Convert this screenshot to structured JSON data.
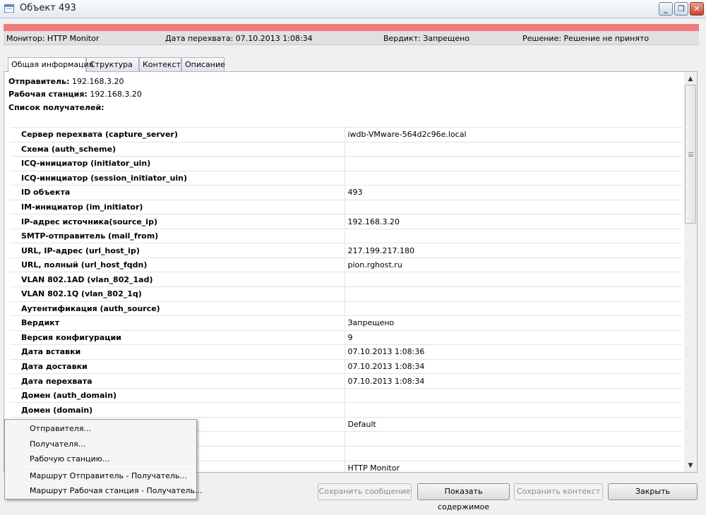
{
  "window": {
    "title": "Объект 493",
    "minimize_label": "_",
    "maximize_label": "❐",
    "close_label": "✕"
  },
  "status": {
    "monitor": "Монитор: HTTP Monitor",
    "capture_date": "Дата перехвата: 07.10.2013 1:08:34",
    "verdict": "Вердикт: Запрещено",
    "decision": "Решение: Решение не принято",
    "bar_color": "#ee7b79"
  },
  "tabs": [
    {
      "label": "Общая информация"
    },
    {
      "label": "Структура"
    },
    {
      "label": "Контекст"
    },
    {
      "label": "Описание"
    }
  ],
  "header": {
    "sender_label": "Отправитель:",
    "sender_value": "192.168.3.20",
    "workstation_label": "Рабочая станция:",
    "workstation_value": "192.168.3.20",
    "recipients_label": "Список получателей:"
  },
  "properties": [
    {
      "key": "Сервер перехвата (capture_server)",
      "value": "iwdb-VMware-564d2c96e.local"
    },
    {
      "key": "Схема (auth_scheme)",
      "value": ""
    },
    {
      "key": "ICQ-инициатор (initiator_uin)",
      "value": ""
    },
    {
      "key": "ICQ-инициатор (session_initiator_uin)",
      "value": ""
    },
    {
      "key": "ID объекта",
      "value": "493"
    },
    {
      "key": "IM-инициатор (im_initiator)",
      "value": ""
    },
    {
      "key": "IP-адрес источника(source_ip)",
      "value": "192.168.3.20"
    },
    {
      "key": "SMTP-отправитель (mail_from)",
      "value": ""
    },
    {
      "key": "URL, IP-адрес (url_host_ip)",
      "value": "217.199.217.180"
    },
    {
      "key": "URL, полный (url_host_fqdn)",
      "value": "pion.rghost.ru"
    },
    {
      "key": "VLAN 802.1AD (vlan_802_1ad)",
      "value": ""
    },
    {
      "key": "VLAN 802.1Q (vlan_802_1q)",
      "value": ""
    },
    {
      "key": "Аутентификация (auth_source)",
      "value": ""
    },
    {
      "key": "Вердикт",
      "value": "Запрещено"
    },
    {
      "key": "Версия конфигурации",
      "value": "9"
    },
    {
      "key": "Дата вставки",
      "value": "07.10.2013 1:08:36"
    },
    {
      "key": "Дата доставки",
      "value": "07.10.2013 1:08:34"
    },
    {
      "key": "Дата перехвата",
      "value": "07.10.2013 1:08:34"
    },
    {
      "key": "Домен (auth_domain)",
      "value": ""
    },
    {
      "key": "Домен (domain)",
      "value": ""
    },
    {
      "key": "",
      "value": "Default"
    },
    {
      "key": "",
      "value": ""
    },
    {
      "key": "",
      "value": ""
    },
    {
      "key": "",
      "value": "HTTP Monitor"
    }
  ],
  "scrollbar": {
    "up_icon": "▲",
    "down_icon": "▼"
  },
  "context_menu": {
    "items": [
      "Отправителя...",
      "Получателя...",
      "Рабочую станцию...",
      "Маршрут Отправитель - Получатель...",
      "Маршрут Рабочая станция - Получатель..."
    ]
  },
  "buttons": {
    "save_message": "Сохранить сообщение",
    "show_content": "Показать содержимое",
    "save_context": "Сохранить контекст",
    "close": "Закрыть"
  }
}
